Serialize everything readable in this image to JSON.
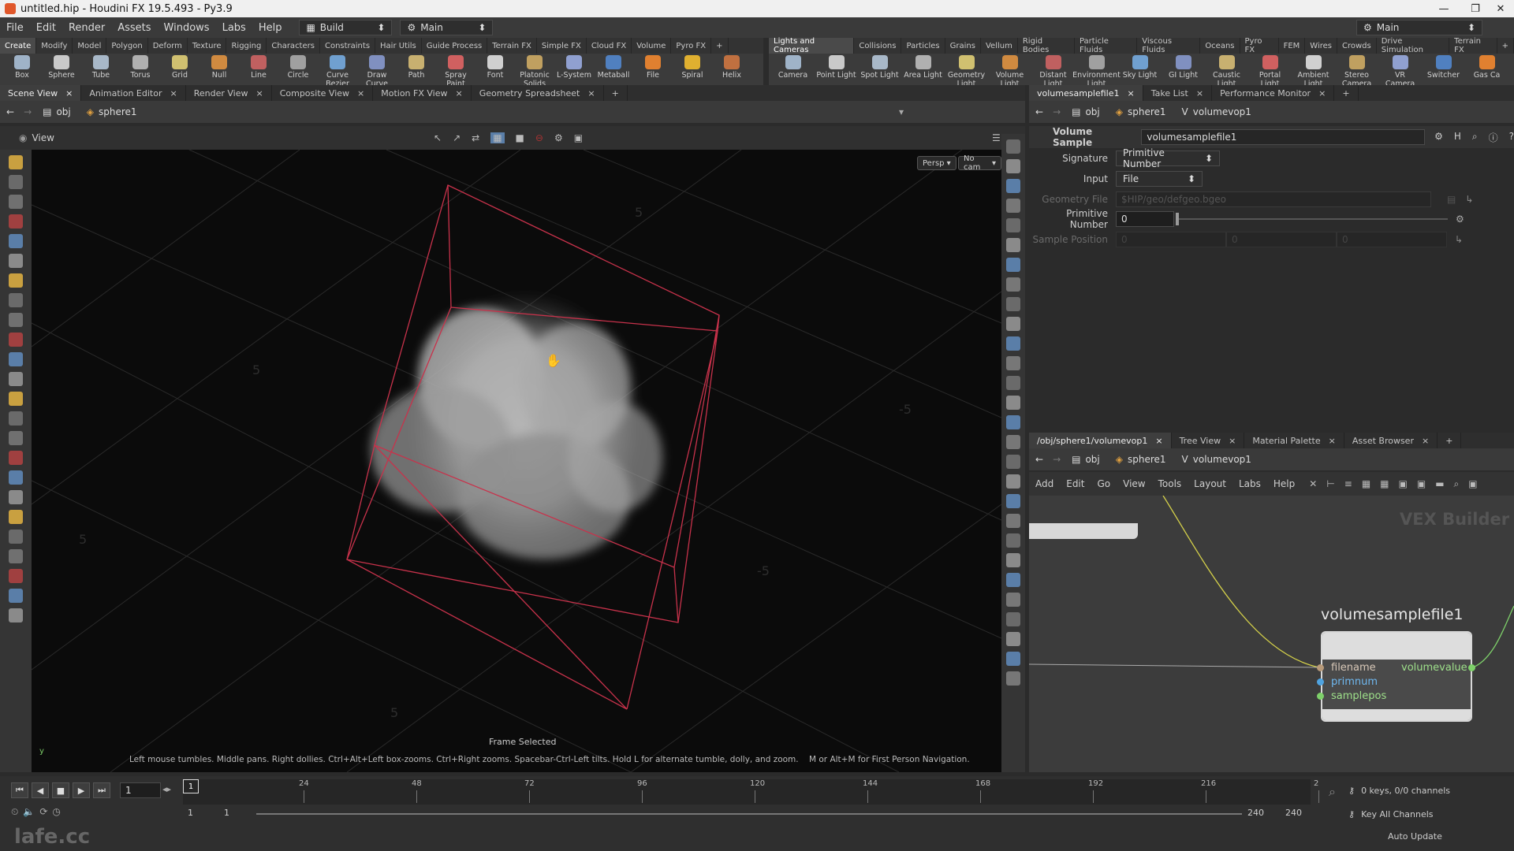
{
  "window": {
    "title": "untitled.hip - Houdini FX 19.5.493 - Py3.9",
    "controls": [
      "—",
      "❐",
      "✕"
    ]
  },
  "menu": {
    "items": [
      "File",
      "Edit",
      "Render",
      "Assets",
      "Windows",
      "Labs",
      "Help"
    ],
    "desktop": "Build",
    "network_context": "Main",
    "right_desktop": "Main"
  },
  "shelf_left": {
    "tabs": [
      "Create",
      "Modify",
      "Model",
      "Polygon",
      "Deform",
      "Texture",
      "Rigging",
      "Characters",
      "Constraints",
      "Hair Utils",
      "Guide Process",
      "Terrain FX",
      "Simple FX",
      "Cloud FX",
      "Volume",
      "Pyro FX"
    ],
    "tools": [
      "Box",
      "Sphere",
      "Tube",
      "Torus",
      "Grid",
      "Null",
      "Line",
      "Circle",
      "Curve Bezier",
      "Draw Curve",
      "Path",
      "Spray Paint",
      "Font",
      "Platonic Solids",
      "L-System",
      "Metaball",
      "File",
      "Spiral",
      "Helix"
    ]
  },
  "shelf_right": {
    "tabs": [
      "Lights and Cameras",
      "Collisions",
      "Particles",
      "Grains",
      "Vellum",
      "Rigid Bodies",
      "Particle Fluids",
      "Viscous Fluids",
      "Oceans",
      "Pyro FX",
      "FEM",
      "Wires",
      "Crowds",
      "Drive Simulation",
      "Terrain FX"
    ],
    "tools": [
      "Camera",
      "Point Light",
      "Spot Light",
      "Area Light",
      "Geometry Light",
      "Volume Light",
      "Distant Light",
      "Environment Light",
      "Sky Light",
      "GI Light",
      "Caustic Light",
      "Portal Light",
      "Ambient Light",
      "Stereo Camera",
      "VR Camera",
      "Switcher",
      "Gas Ca"
    ]
  },
  "left_pane": {
    "tabs": [
      "Scene View",
      "Animation Editor",
      "Render View",
      "Composite View",
      "Motion FX View",
      "Geometry Spreadsheet"
    ],
    "path": [
      "obj",
      "sphere1"
    ],
    "view_label": "View",
    "persp": "Persp",
    "cam": "No cam",
    "frame_msg": "Frame Selected",
    "help_text": "Left mouse tumbles. Middle pans. Right dollies. Ctrl+Alt+Left box-zooms. Ctrl+Right zooms. Spacebar-Ctrl-Left tilts. Hold L for alternate tumble, dolly, and zoom.    M or Alt+M for First Person Navigation.",
    "grid_labels": [
      "5",
      "5",
      "5",
      "-5",
      "-5",
      "5"
    ]
  },
  "param_pane": {
    "tabs": [
      "volumesamplefile1",
      "Take List",
      "Performance Monitor"
    ],
    "path": [
      "obj",
      "sphere1",
      "volumevop1"
    ],
    "node_type": "Volume Sample",
    "node_name": "volumesamplefile1",
    "signature_label": "Signature",
    "signature_value": "Primitive Number",
    "input_label": "Input",
    "input_value": "File",
    "geofile_label": "Geometry File",
    "geofile_value": "$HIP/geo/defgeo.bgeo",
    "primnum_label": "Primitive Number",
    "primnum_value": "0",
    "samplepos_label": "Sample Position",
    "samplepos_values": [
      "0",
      "0",
      "0"
    ]
  },
  "network_pane": {
    "tabs": [
      "/obj/sphere1/volumevop1",
      "Tree View",
      "Material Palette",
      "Asset Browser"
    ],
    "path": [
      "obj",
      "sphere1",
      "volumevop1"
    ],
    "menu": [
      "Add",
      "Edit",
      "Go",
      "View",
      "Tools",
      "Layout",
      "Labs",
      "Help"
    ],
    "watermark": "VEX Builder",
    "node_title": "volumesamplefile1",
    "inputs": [
      "filename",
      "primnum",
      "samplepos"
    ],
    "output": "volumevalue"
  },
  "timeline": {
    "ticks": [
      "1",
      "24",
      "48",
      "72",
      "96",
      "120",
      "144",
      "168",
      "192",
      "216",
      "2"
    ],
    "current_frame": "1",
    "start": "1",
    "start2": "1",
    "end": "240",
    "end2": "240",
    "keys": "0 keys, 0/0 channels",
    "key_all": "Key All Channels",
    "auto_update": "Auto Update"
  },
  "watermark": "lafe.cc",
  "colors": {
    "accent": "#e0572a",
    "bbox": "#c8324b",
    "port_filename": "#b89a7a",
    "port_primnum": "#4fa3e0",
    "port_samplepos": "#7ed06a",
    "wire": "#d6d24a"
  }
}
